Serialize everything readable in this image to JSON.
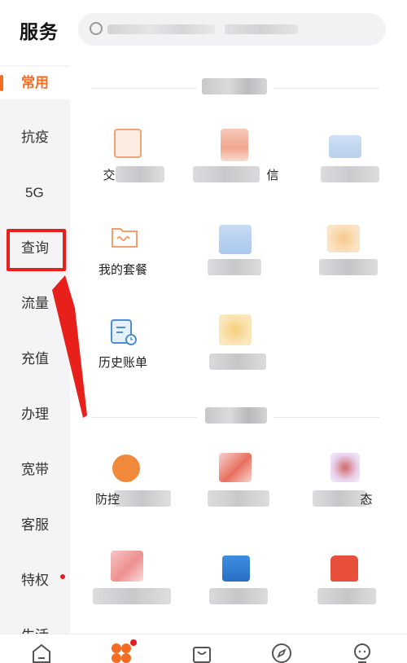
{
  "header": {
    "title": "服务",
    "search_placeholder": ""
  },
  "sidebar": {
    "items": [
      {
        "label": "常用",
        "active": true
      },
      {
        "label": "抗疫"
      },
      {
        "label": "5G"
      },
      {
        "label": "查询",
        "highlighted": true
      },
      {
        "label": "流量"
      },
      {
        "label": "充值"
      },
      {
        "label": "办理"
      },
      {
        "label": "宽带"
      },
      {
        "label": "客服"
      },
      {
        "label": "特权",
        "badge": true
      },
      {
        "label": "生活"
      }
    ]
  },
  "main": {
    "cells": [
      {
        "label": "交"
      },
      {
        "label": "信"
      },
      {
        "label": ""
      },
      {
        "label": "我的套餐"
      },
      {
        "label": ""
      },
      {
        "label": ""
      },
      {
        "label": "历史账单"
      },
      {
        "label": ""
      },
      {
        "label": "防控"
      },
      {
        "label": ""
      },
      {
        "label": "态"
      },
      {
        "label": ""
      },
      {
        "label": ""
      },
      {
        "label": ""
      }
    ]
  },
  "colors": {
    "accent": "#f46b22",
    "annotation_red": "#e8201c",
    "badge_red": "#e41e1e"
  },
  "bottom_nav": {
    "icons": [
      "home-icon",
      "services-icon",
      "shopping-bag-icon",
      "compass-icon",
      "profile-icon"
    ]
  }
}
